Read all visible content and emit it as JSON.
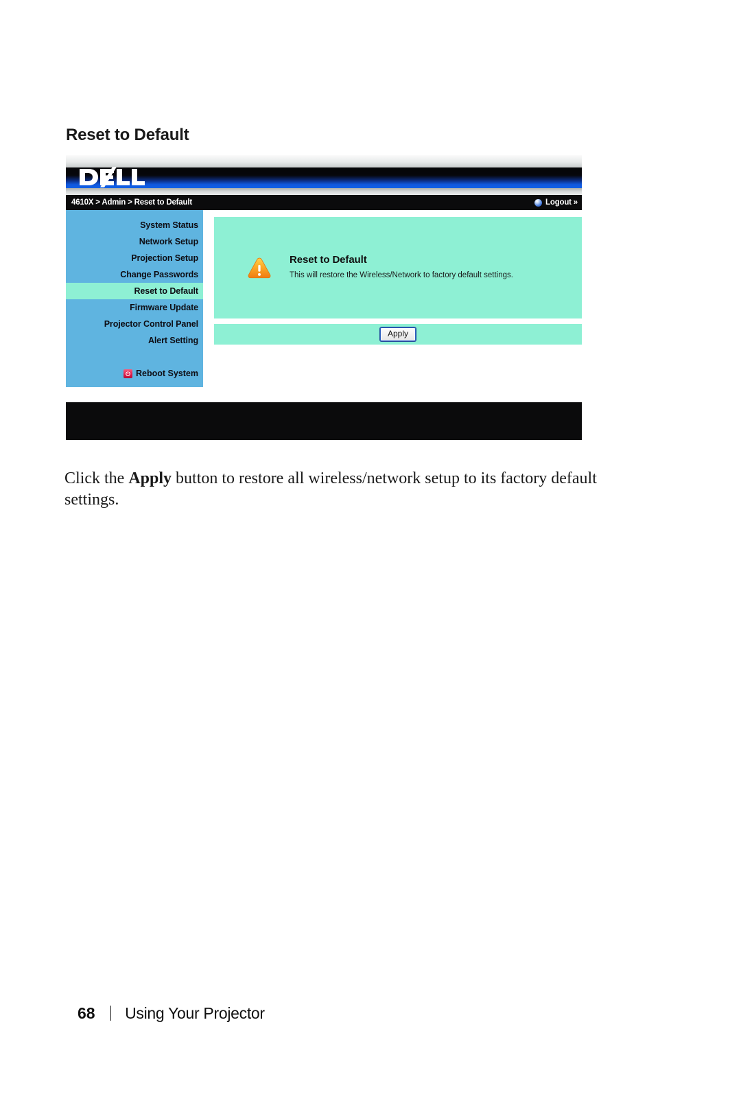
{
  "page": {
    "heading": "Reset to Default",
    "body_copy_before": "Click the ",
    "body_copy_bold": "Apply",
    "body_copy_after": " button to restore all wireless/network setup to its factory default settings.",
    "folio_number": "68",
    "folio_label": "Using Your Projector"
  },
  "app": {
    "brand": "DELL",
    "breadcrumb": "4610X > Admin > Reset to Default",
    "logout_label": "Logout »",
    "logout_icon": "blue-orb-icon"
  },
  "sidebar": {
    "items": [
      {
        "label": "System Status",
        "active": false
      },
      {
        "label": "Network Setup",
        "active": false
      },
      {
        "label": "Projection Setup",
        "active": false
      },
      {
        "label": "Change Passwords",
        "active": false
      },
      {
        "label": "Reset to Default",
        "active": true
      },
      {
        "label": "Firmware Update",
        "active": false
      },
      {
        "label": "Projector Control Panel",
        "active": false
      },
      {
        "label": "Alert Setting",
        "active": false
      }
    ],
    "reboot": {
      "label": "Reboot System",
      "icon": "power-icon"
    }
  },
  "main": {
    "warning_icon": "warning-triangle-icon",
    "title": "Reset to Default",
    "description": "This will restore the Wireless/Network to factory default settings.",
    "apply_label": "Apply"
  },
  "colors": {
    "sidebar_bg": "#5fb4e0",
    "panel_bg": "#8ef0d4",
    "active_item_bg": "#8ef0d4",
    "bar_black": "#0b0b0c",
    "accent_blue": "#1060e8",
    "warning_orange": "#f5a623",
    "power_red": "#e31c4b"
  }
}
